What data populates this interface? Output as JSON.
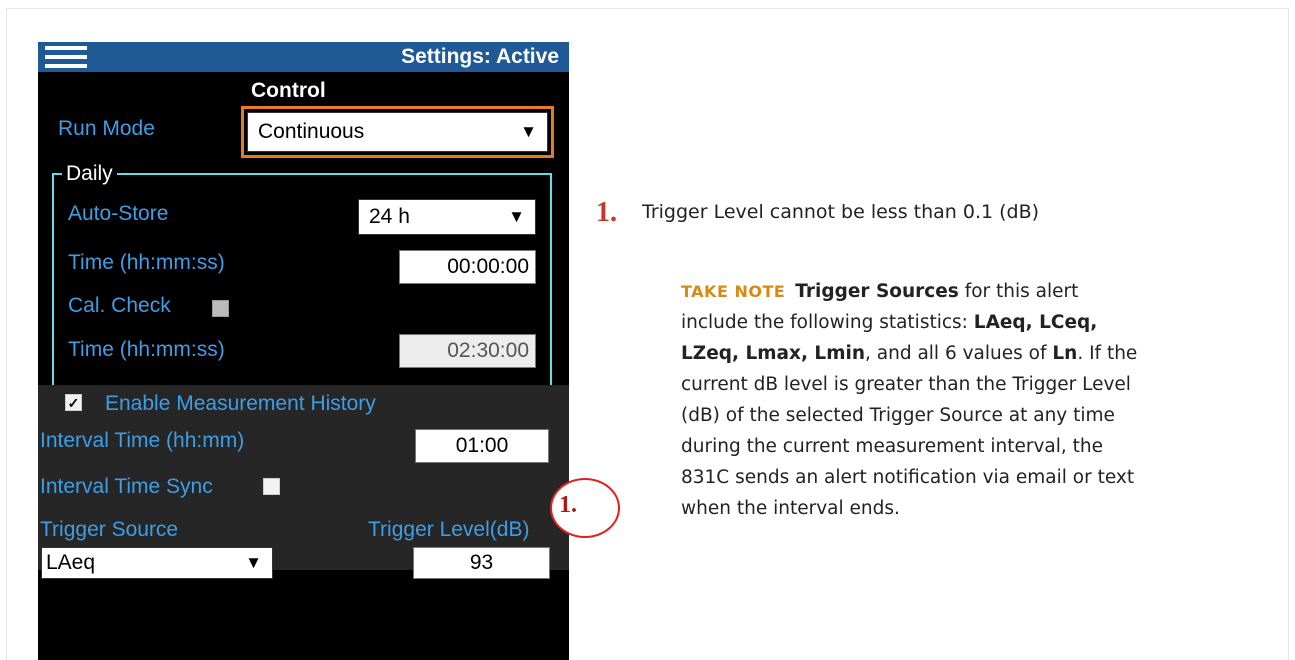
{
  "header": {
    "title": "Settings: Active"
  },
  "control": {
    "section_title": "Control",
    "run_mode_label": "Run Mode",
    "run_mode_value": "Continuous"
  },
  "daily": {
    "legend": "Daily",
    "auto_store_label": "Auto-Store",
    "auto_store_value": "24 h",
    "time1_label": "Time (hh:mm:ss)",
    "time1_value": "00:00:00",
    "cal_check_label": "Cal. Check",
    "cal_check_checked": false,
    "time2_label": "Time (hh:mm:ss)",
    "time2_value": "02:30:00"
  },
  "history": {
    "enable_label": "Enable Measurement History",
    "enable_checked": true,
    "interval_time_label": "Interval Time (hh:mm)",
    "interval_time_value": "01:00",
    "interval_sync_label": "Interval Time Sync",
    "interval_sync_checked": false,
    "trigger_source_label": "Trigger Source",
    "trigger_source_value": "LAeq",
    "trigger_level_label": "Trigger Level(dB)",
    "trigger_level_value": "93"
  },
  "callout": {
    "number": "1."
  },
  "instructions": {
    "step_number": "1.",
    "step_text": "Trigger Level cannot be less than 0.1 (dB)",
    "note_label": "TAKE NOTE",
    "note_parts": [
      "Trigger Sources",
      " for this alert include the following statistics: ",
      "LAeq, LCeq, LZeq, Lmax, Lmin",
      ", and all 6 values of ",
      "Ln",
      ". If the current dB level is greater than the Trigger Level (dB) of the selected Trigger Source at any time during the current measurement interval, the 831C sends an alert notification via email or text when the interval ends."
    ]
  },
  "colors": {
    "title_bar": "#1f5a96",
    "label_blue": "#3d9ee6",
    "highlight_orange": "#e87a20",
    "daily_border": "#5ee0e0",
    "callout_red": "#e02020",
    "note_gold": "#d68a12"
  },
  "icons": {
    "menu": "hamburger-menu-icon",
    "dropdown": "dropdown-arrow-icon",
    "check": "checkmark-icon"
  }
}
